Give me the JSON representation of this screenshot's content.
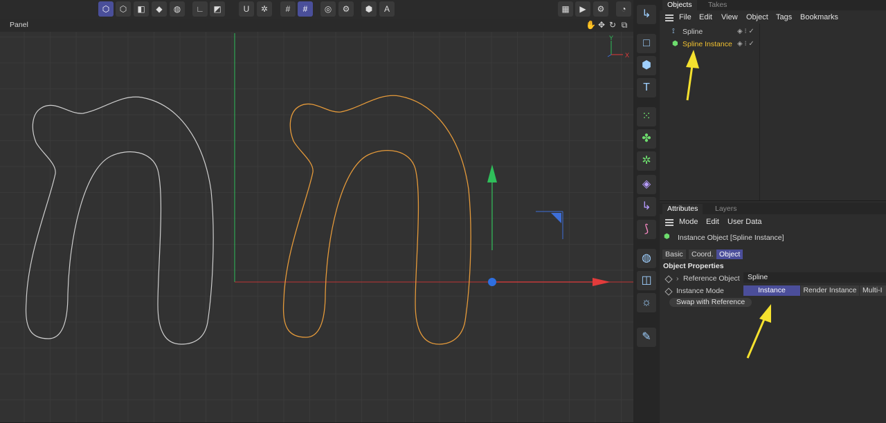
{
  "viewport": {
    "panel_label": "Panel",
    "axis_y_label": "Y",
    "axis_x_label": "X"
  },
  "toolbar": {
    "icons": [
      "model-mode-icon",
      "edge-mode-icon",
      "polygon-mode-icon",
      "object-mode-icon",
      "texture-mode-icon",
      "axis-mode-icon",
      "solo-icon",
      "magnet-icon",
      "snap-settings-icon",
      "grid-icon",
      "workplane-icon",
      "render-settings-icon",
      "gear-icon",
      "stream-icon",
      "polygon-pen-icon",
      "render-view-icon",
      "render-picture-viewer-icon",
      "render-settings-icon",
      "cycle-icon"
    ]
  },
  "objects_panel": {
    "tabs": [
      {
        "label": "Objects",
        "active": true
      },
      {
        "label": "Takes",
        "active": false
      }
    ],
    "menu": [
      "File",
      "Edit",
      "View",
      "Object",
      "Tags",
      "Bookmarks"
    ],
    "rows": [
      {
        "name": "Spline",
        "selected": false,
        "color": "#cfcfcf"
      },
      {
        "name": "Spline Instance",
        "selected": true,
        "color": "#f2c230"
      }
    ]
  },
  "attributes_panel": {
    "tabs": [
      {
        "label": "Attributes",
        "active": true
      },
      {
        "label": "Layers",
        "active": false
      }
    ],
    "menu": [
      "Mode",
      "Edit",
      "User Data"
    ],
    "object_title": "Instance Object [Spline Instance]",
    "sub_tabs": [
      {
        "label": "Basic",
        "active": false
      },
      {
        "label": "Coord.",
        "active": false
      },
      {
        "label": "Object",
        "active": true
      }
    ],
    "section_title": "Object Properties",
    "reference_label": "Reference Object",
    "reference_value": "Spline",
    "instance_mode_label": "Instance Mode",
    "instance_mode_options": [
      {
        "label": "Instance",
        "active": true
      },
      {
        "label": "Render Instance",
        "active": false
      },
      {
        "label": "Multi-I",
        "active": false
      }
    ],
    "swap_button": "Swap with Reference"
  },
  "colors": {
    "accent": "#4b4e9a",
    "selected_object": "#f2c230",
    "instance_spline": "#e59a3a",
    "annotation_arrow": "#f5e12e",
    "axis_x": "#e23b3b",
    "axis_y": "#2fbf5a",
    "handle": "#2f6fe0"
  }
}
